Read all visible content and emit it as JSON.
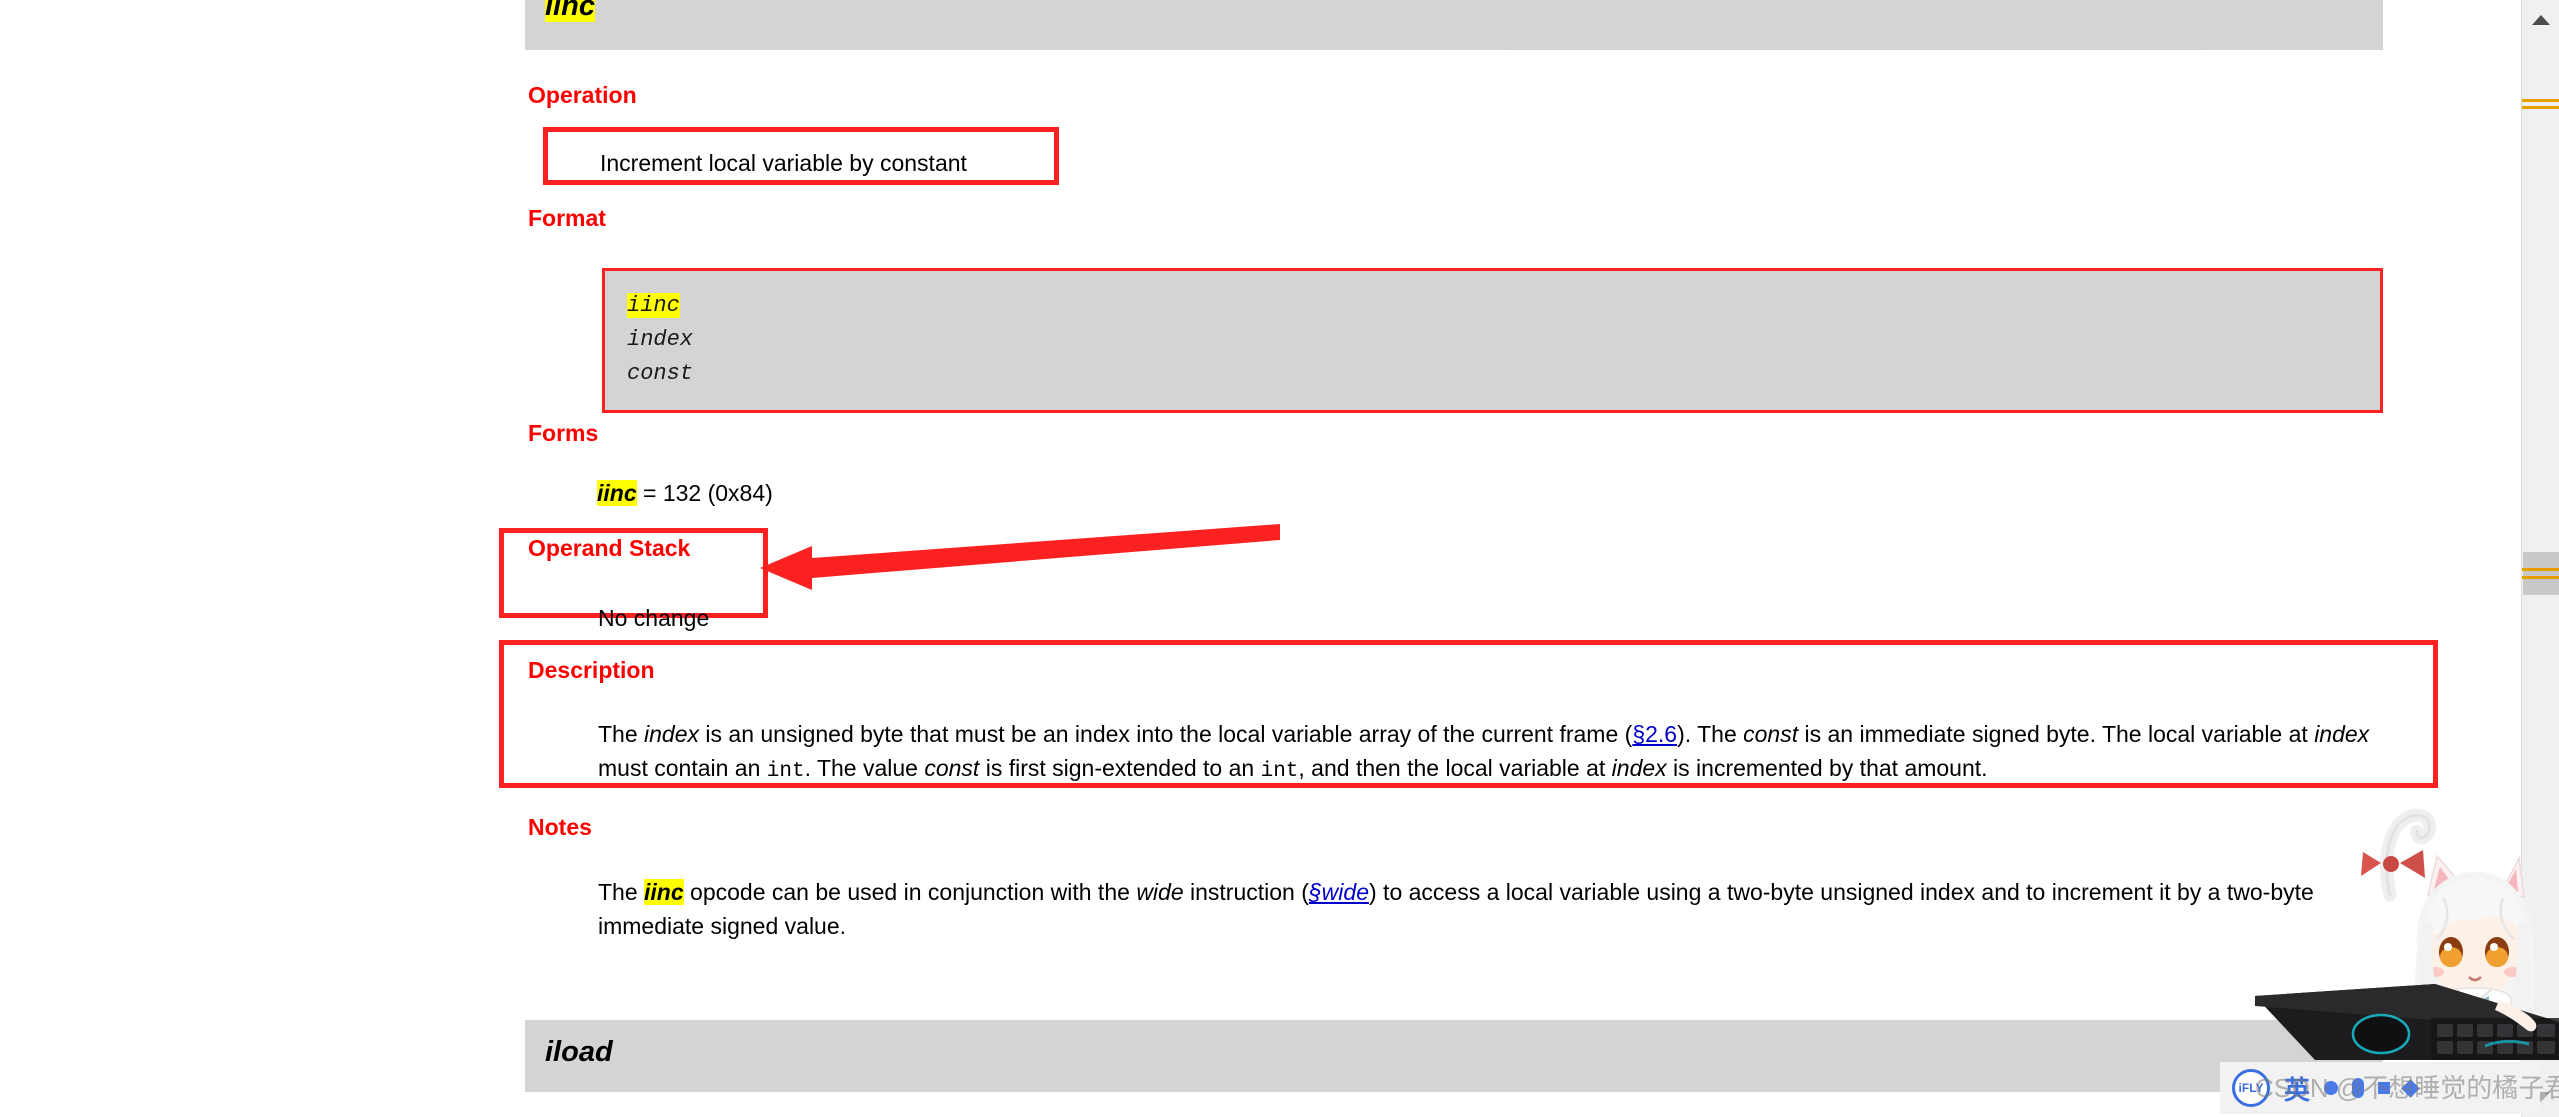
{
  "document": {
    "opcode_header": {
      "name": "iinc"
    },
    "sections": {
      "operation": {
        "heading": "Operation",
        "text": "Increment local variable by constant"
      },
      "format": {
        "heading": "Format",
        "code_lines": [
          "iinc",
          "index",
          "const"
        ],
        "highlighted_line": "iinc"
      },
      "forms": {
        "heading": "Forms",
        "value_name": "iinc",
        "value_rest": " = 132 (0x84)"
      },
      "operand_stack": {
        "heading": "Operand Stack",
        "text": "No change"
      },
      "description": {
        "heading": "Description",
        "p1_a": "The ",
        "p1_index1": "index",
        "p1_b": " is an unsigned byte that must be an index into the local variable array of the current frame (",
        "p1_link": "§2.6",
        "p1_c": "). The ",
        "p1_const": "const",
        "p1_d": " is an immediate signed byte. The local variable at ",
        "p1_index2": "index",
        "p1_e": " must contain an ",
        "p1_int1": "int",
        "p1_f": ". The value ",
        "p1_const2": "const",
        "p1_g": " is first sign-extended to an ",
        "p1_int2": "int",
        "p1_h": ", and then the local variable at ",
        "p1_index3": "index",
        "p1_i": " is incremented by that amount."
      },
      "notes": {
        "heading": "Notes",
        "p1_a": "The ",
        "p1_iinc": "iinc",
        "p1_b": " opcode can be used in conjunction with the ",
        "p1_wide": "wide",
        "p1_c": " instruction (",
        "p1_link": "§wide",
        "p1_d": ") to access a local variable using a two-byte unsigned index and to increment it by a two-byte immediate signed value."
      }
    },
    "next_opcode_header": {
      "name": "iload"
    }
  },
  "scrollbar": {
    "up_arrow": "▲",
    "down_arrow": "▼"
  },
  "ime": {
    "logo_text": "iFLY",
    "mode_label": "英"
  },
  "watermark": {
    "text": "CSDN @不想睡觉的橘子君"
  },
  "colors": {
    "annotation_red": "#fb2121",
    "heading_red": "#ff0000",
    "highlight_yellow": "#ffff00",
    "code_bg_gray": "#d4d4d4",
    "link_blue": "#0000cc",
    "scrollbar_mark": "#e8a000"
  }
}
